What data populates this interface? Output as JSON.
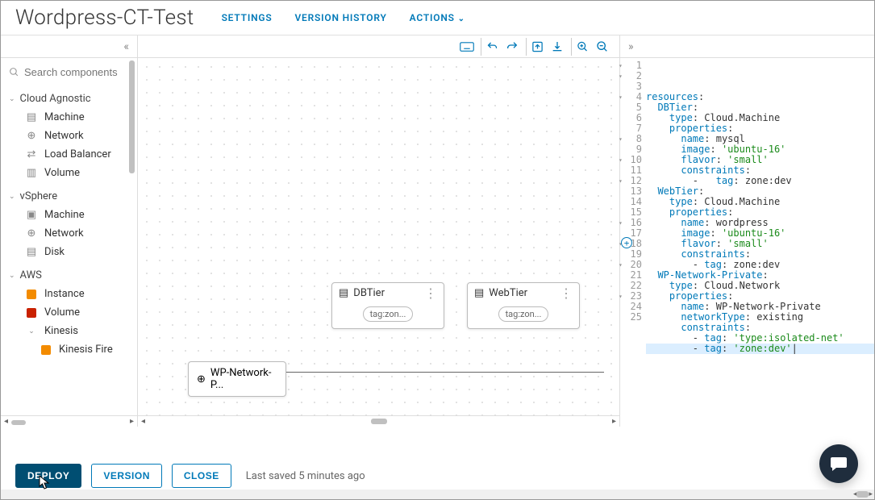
{
  "page_title": "Wordpress-CT-Test",
  "tabs": {
    "settings": "SETTINGS",
    "version_history": "VERSION HISTORY",
    "actions": "ACTIONS"
  },
  "sidebar": {
    "search_placeholder": "Search components",
    "groups": [
      {
        "name": "Cloud Agnostic",
        "items": [
          {
            "label": "Machine",
            "icon": "server-icon"
          },
          {
            "label": "Network",
            "icon": "globe-icon"
          },
          {
            "label": "Load Balancer",
            "icon": "balancer-icon"
          },
          {
            "label": "Volume",
            "icon": "volume-icon"
          }
        ]
      },
      {
        "name": "vSphere",
        "items": [
          {
            "label": "Machine",
            "icon": "vm-icon"
          },
          {
            "label": "Network",
            "icon": "globe-icon"
          },
          {
            "label": "Disk",
            "icon": "disk-icon"
          }
        ]
      },
      {
        "name": "AWS",
        "items": [
          {
            "label": "Instance",
            "icon": "orange-square"
          },
          {
            "label": "Volume",
            "icon": "red-square"
          },
          {
            "label": "Kinesis",
            "icon": "chevron-item",
            "expandable": true
          },
          {
            "label": "Kinesis Fire",
            "icon": "orange-square",
            "indent": true
          }
        ]
      }
    ]
  },
  "canvas": {
    "nodes": {
      "db": {
        "label": "DBTier",
        "tag": "tag:zon..."
      },
      "web": {
        "label": "WebTier",
        "tag": "tag:zon..."
      },
      "net": {
        "label": "WP-Network-P..."
      }
    }
  },
  "code_lines": [
    {
      "n": 1,
      "fold": true,
      "html": "<span class='kw'>resources</span>:"
    },
    {
      "n": 2,
      "fold": true,
      "html": "  <span class='kw'>DBTier</span>:"
    },
    {
      "n": 3,
      "html": "    <span class='kw'>type</span>: Cloud.Machine"
    },
    {
      "n": 4,
      "fold": true,
      "html": "    <span class='kw'>properties</span>:"
    },
    {
      "n": 5,
      "html": "      <span class='kw'>name</span>: mysql"
    },
    {
      "n": 6,
      "html": "      <span class='kw'>image</span>: <span class='str'>'ubuntu-16'</span>"
    },
    {
      "n": 7,
      "html": "      <span class='kw'>flavor</span>: <span class='str'>'small'</span>"
    },
    {
      "n": 8,
      "fold": true,
      "html": "      <span class='kw'>constraints</span>:"
    },
    {
      "n": 9,
      "html": "        -   <span class='kw'>tag</span>: zone:dev"
    },
    {
      "n": 10,
      "fold": true,
      "html": "  <span class='kw'>WebTier</span>:"
    },
    {
      "n": 11,
      "html": "    <span class='kw'>type</span>: Cloud.Machine"
    },
    {
      "n": 12,
      "fold": true,
      "html": "    <span class='kw'>properties</span>:"
    },
    {
      "n": 13,
      "html": "      <span class='kw'>name</span>: wordpress"
    },
    {
      "n": 14,
      "html": "      <span class='kw'>image</span>: <span class='str'>'ubuntu-16'</span>"
    },
    {
      "n": 15,
      "html": "      <span class='kw'>flavor</span>: <span class='str'>'small'</span>"
    },
    {
      "n": 16,
      "fold": true,
      "html": "      <span class='kw'>constraints</span>:"
    },
    {
      "n": 17,
      "html": "        - <span class='kw'>tag</span>: zone:dev"
    },
    {
      "n": 18,
      "fold": true,
      "html": "  <span class='kw'>WP-Network-Private</span>:"
    },
    {
      "n": 19,
      "html": "    <span class='kw'>type</span>: Cloud.Network"
    },
    {
      "n": 20,
      "fold": true,
      "html": "    <span class='kw'>properties</span>:"
    },
    {
      "n": 21,
      "html": "      <span class='kw'>name</span>: WP-Network-Private"
    },
    {
      "n": 22,
      "html": "      <span class='kw'>networkType</span>: existing"
    },
    {
      "n": 23,
      "fold": true,
      "html": "      <span class='kw'>constraints</span>:"
    },
    {
      "n": 24,
      "html": "        - <span class='kw'>tag</span>: <span class='str'>'type:isolated-net'</span>"
    },
    {
      "n": 25,
      "hl": true,
      "html": "        - <span class='kw'>tag</span>: <span class='str'>'zone:dev'</span>|"
    }
  ],
  "footer": {
    "deploy": "DEPLOY",
    "version": "VERSION",
    "close": "CLOSE",
    "saved": "Last saved 5 minutes ago"
  },
  "colors": {
    "accent": "#0079b8",
    "orange": "#f38b00",
    "red": "#c92100"
  }
}
